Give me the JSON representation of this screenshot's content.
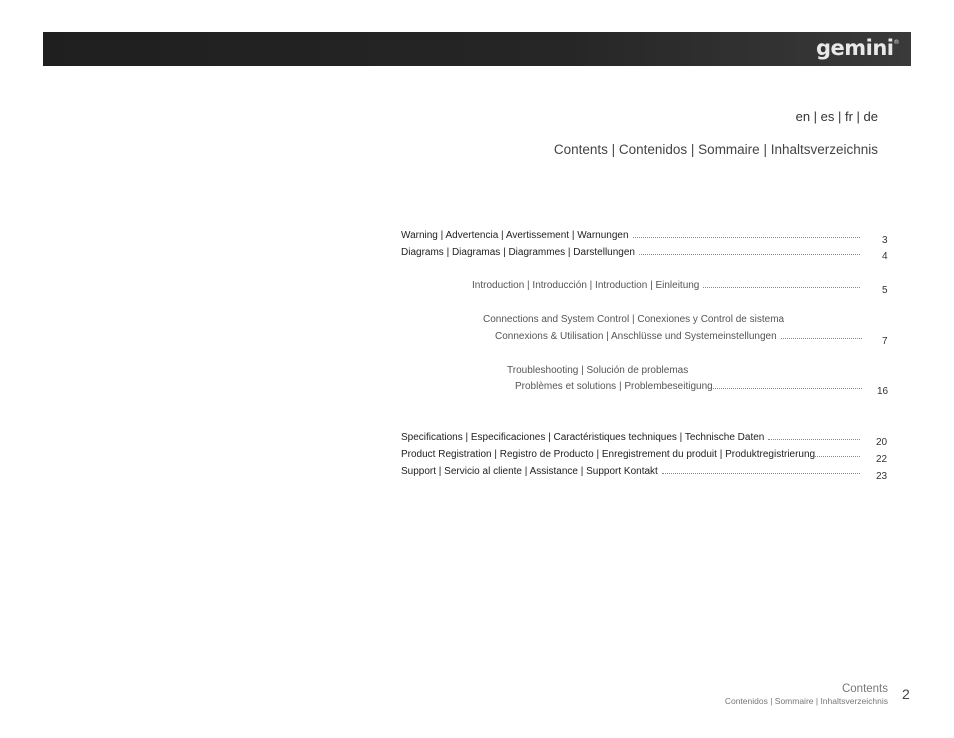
{
  "header": {
    "brand": "gemini",
    "trademark": "®"
  },
  "languages": "en | es | fr | de",
  "page_title": "Contents | Contenidos | Sommaire | Inhaltsverzeichnis",
  "toc": [
    {
      "lines": [
        "Warning | Advertencia | Avertissement | Warnungen"
      ],
      "page": "3"
    },
    {
      "lines": [
        "Diagrams | Diagramas | Diagrammes | Darstellungen"
      ],
      "page": "4"
    },
    {
      "lines": [
        "Introduction | Introducción | Introduction | Einleitung"
      ],
      "page": "5"
    },
    {
      "lines": [
        "Connections and System Control | Conexiones y Control de sistema",
        "Connexions & Utilisation |  Anschlüsse und Systemeinstellungen"
      ],
      "page": "7"
    },
    {
      "lines": [
        "Troubleshooting | Solución de problemas",
        "Problèmes et solutions | Problembeseitigung"
      ],
      "page": "16"
    },
    {
      "lines": [
        "Specifications | Especificaciones | Caractéristiques techniques | Technische Daten"
      ],
      "page": "20"
    },
    {
      "lines": [
        "Product Registration | Registro de Producto | Enregistrement du produit | Produktregistrierung"
      ],
      "page": "22"
    },
    {
      "lines": [
        "Support | Servicio al cliente | Assistance | Support Kontakt"
      ],
      "page": "23"
    }
  ],
  "footer": {
    "section": "Contents",
    "section_sub": "Contenidos | Sommaire | Inhaltsverzeichnis",
    "page_number": "2"
  }
}
